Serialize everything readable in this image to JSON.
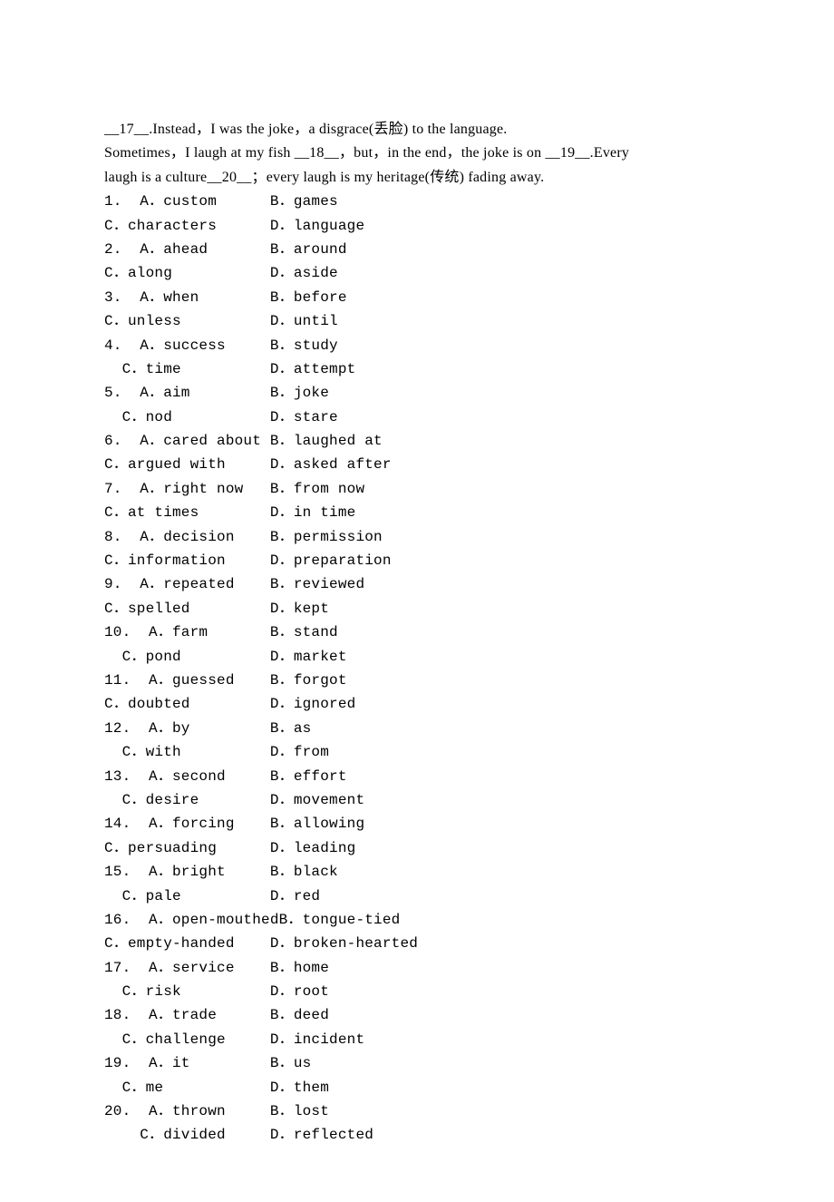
{
  "passage": {
    "l1_a": "__17__.Instead，I was the joke，a disgrace(丢脸) to the language.",
    "l2": "Sometimes，I laugh at my fish __18__，but，in the end，the joke is on __19__.Every",
    "l3": "laugh is a culture__20__；every laugh is my heritage(传统) fading away."
  },
  "questions": [
    {
      "n": "1.",
      "a": "A．custom",
      "b": "B．games",
      "c": "C．characters",
      "d": "D．language"
    },
    {
      "n": "2.",
      "a": "A．ahead",
      "b": "B．around",
      "c": "C．along",
      "d": "D．aside"
    },
    {
      "n": "3.",
      "a": "A．when",
      "b": "B．before",
      "c": "C．unless",
      "d": "D．until"
    },
    {
      "n": "4.",
      "a": "A．success",
      "b": "B．study",
      "c": "C．time",
      "d": "D．attempt",
      "indent": true
    },
    {
      "n": "5.",
      "a": "A．aim",
      "b": "B．joke",
      "c": "C．nod",
      "d": "D．stare",
      "indent": true
    },
    {
      "n": "6.",
      "a": "A．cared about",
      "b": "B．laughed at",
      "c": "C．argued with",
      "d": "D．asked after"
    },
    {
      "n": "7.",
      "a": "A．right now",
      "b": "B．from now",
      "c": "C．at times",
      "d": "D．in time"
    },
    {
      "n": "8.",
      "a": "A．decision",
      "b": "B．permission",
      "c": "C．information",
      "d": "D．preparation"
    },
    {
      "n": "9.",
      "a": "A．repeated",
      "b": "B．reviewed",
      "c": "C．spelled",
      "d": "D．kept"
    },
    {
      "n": "10.",
      "a": "A．farm",
      "b": "B．stand",
      "c": "C．pond",
      "d": "D．market",
      "indent": true
    },
    {
      "n": "11.",
      "a": "A．guessed",
      "b": "B．forgot",
      "c": "C．doubted",
      "d": "D．ignored"
    },
    {
      "n": "12.",
      "a": "A．by",
      "b": "B．as",
      "c": "C．with",
      "d": "D．from",
      "indent": true
    },
    {
      "n": "13.",
      "a": "A．second",
      "b": "B．effort",
      "c": "C．desire",
      "d": "D．movement",
      "indent": true
    },
    {
      "n": "14.",
      "a": "A．forcing",
      "b": "B．allowing",
      "c": "C．persuading",
      "d": "D．leading"
    },
    {
      "n": "15.",
      "a": "A．bright",
      "b": "B．black",
      "c": "C．pale",
      "d": "D．red",
      "indent": true
    },
    {
      "n": "16.",
      "a": "A．open-mouthed",
      "b": "B．tongue-tied",
      "c": "C．empty-handed",
      "d": "D．broken-hearted"
    },
    {
      "n": "17.",
      "a": "A．service",
      "b": "B．home",
      "c": "C．risk",
      "d": "D．root",
      "indent": true
    },
    {
      "n": "18.",
      "a": "A．trade",
      "b": "B．deed",
      "c": "C．challenge",
      "d": "D．incident",
      "indent": true
    },
    {
      "n": "19.",
      "a": "A．it",
      "b": "B．us",
      "c": "C．me",
      "d": "D．them",
      "indent": true
    },
    {
      "n": "20.",
      "a": "A．thrown",
      "b": "B．lost",
      "c": "C．divided",
      "d": "D．reflected",
      "indent2": true
    }
  ]
}
